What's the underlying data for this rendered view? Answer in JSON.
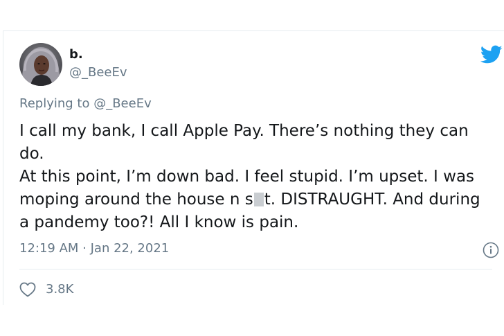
{
  "user": {
    "display_name": "b.",
    "handle": "@_BeeEv"
  },
  "reply": {
    "prefix": "Replying to ",
    "handle": "@_BeeEv"
  },
  "tweet": {
    "line1": "I call my bank, I call Apple Pay. There’s nothing they can do.",
    "line2_before": "At this point, I’m down bad. I feel stupid. I’m upset. I was moping around the house n s",
    "line2_after": "t. DISTRAUGHT. And during a pandemy too?! All I know is pain."
  },
  "meta": {
    "timestamp": "12:19 AM · Jan 22, 2021",
    "likes": "3.8K"
  },
  "icons": {
    "brand": "twitter-bird-icon",
    "info": "info-icon",
    "like": "heart-icon"
  },
  "colors": {
    "twitter_blue": "#1da1f2",
    "text": "#14171a",
    "muted": "#657786",
    "divider": "#e6ecf0"
  }
}
